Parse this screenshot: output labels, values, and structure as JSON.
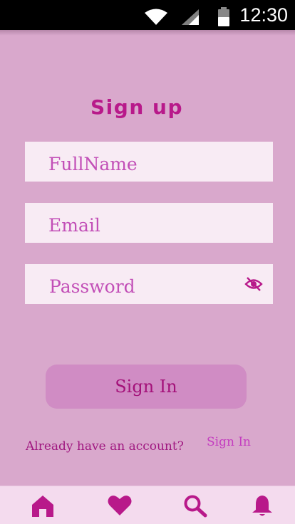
{
  "status_bar": {
    "time": "12:30",
    "icons": [
      "wifi-icon",
      "signal-icon",
      "battery-icon"
    ]
  },
  "form": {
    "title": "Sign up",
    "fullname_placeholder": "FullName",
    "email_placeholder": "Email",
    "password_placeholder": "Password",
    "password_toggle_icon": "eye-off-icon",
    "submit_label": "Sign In"
  },
  "footer": {
    "prompt": "Already have an account?",
    "signin_link": "Sign In"
  },
  "bottom_nav": {
    "items": [
      "home-icon",
      "heart-icon",
      "search-icon",
      "bell-icon"
    ]
  },
  "colors": {
    "background": "#d9a8cc",
    "accent": "#b8198a",
    "field_bg": "#f8ebf4",
    "button_bg": "#d08cc4",
    "nav_bg": "#f4dbee"
  }
}
